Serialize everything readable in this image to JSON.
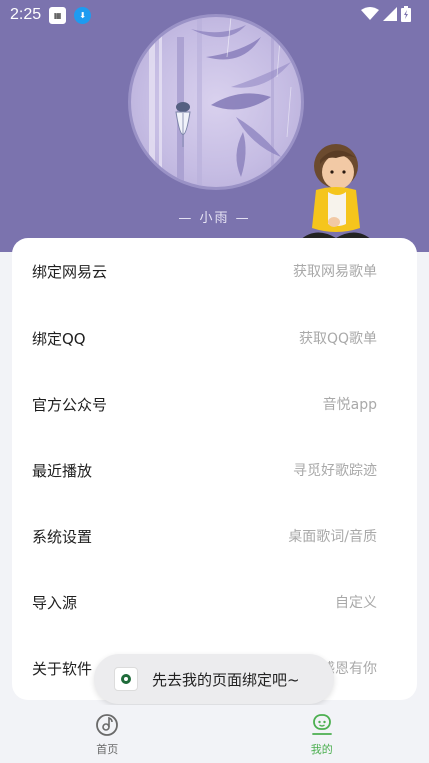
{
  "status_bar": {
    "time": "2:25",
    "icons": [
      "wifi-icon",
      "signal-icon",
      "battery-icon"
    ]
  },
  "profile": {
    "name": "— 小雨 —"
  },
  "menu": [
    {
      "label": "绑定网易云",
      "hint": "获取网易歌单"
    },
    {
      "label": "绑定QQ",
      "hint": "获取QQ歌单"
    },
    {
      "label": "官方公众号",
      "hint": "音悦app"
    },
    {
      "label": "最近播放",
      "hint": "寻觅好歌踪迹"
    },
    {
      "label": "系统设置",
      "hint": "桌面歌词/音质"
    },
    {
      "label": "导入源",
      "hint": "自定义"
    },
    {
      "label": "关于软件",
      "hint": "感恩有你"
    }
  ],
  "toast": {
    "text": "先去我的页面绑定吧~"
  },
  "bottom_nav": {
    "home": "首页",
    "mine": "我的"
  },
  "colors": {
    "header": "#7b73ae",
    "accent": "#4caf50"
  }
}
